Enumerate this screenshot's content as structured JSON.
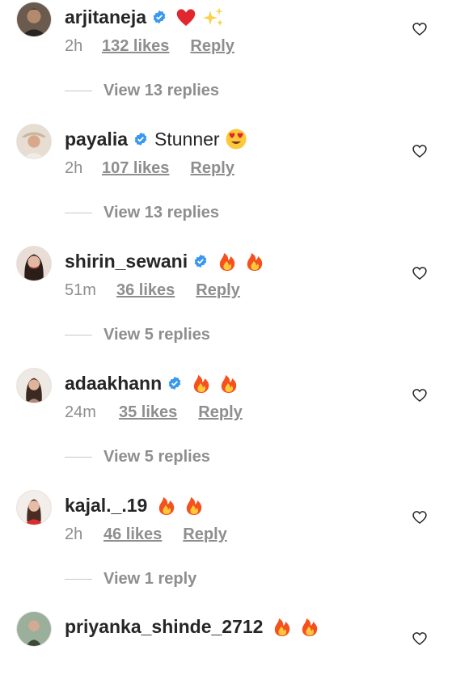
{
  "comments": [
    {
      "username": "arjitaneja",
      "verified": true,
      "text": "",
      "emojis": [
        "red-heart",
        "sparkles"
      ],
      "time": "2h",
      "likes": "132 likes",
      "reply": "Reply",
      "view_replies": "View 13 replies"
    },
    {
      "username": "payalia",
      "verified": true,
      "text": "Stunner",
      "emojis": [
        "heart-eyes"
      ],
      "time": "2h",
      "likes": "107 likes",
      "reply": "Reply",
      "view_replies": "View 13 replies"
    },
    {
      "username": "shirin_sewani",
      "verified": true,
      "text": "",
      "emojis": [
        "fire",
        "fire"
      ],
      "time": "51m",
      "likes": "36 likes",
      "reply": "Reply",
      "view_replies": "View 5 replies"
    },
    {
      "username": "adaakhann",
      "verified": true,
      "text": "",
      "emojis": [
        "fire",
        "fire"
      ],
      "time": "24m",
      "likes": "35 likes",
      "reply": "Reply",
      "view_replies": "View 5 replies"
    },
    {
      "username": "kajal._.19",
      "verified": false,
      "text": "",
      "emojis": [
        "fire",
        "fire"
      ],
      "time": "2h",
      "likes": "46 likes",
      "reply": "Reply",
      "view_replies": "View 1 reply"
    },
    {
      "username": "priyanka_shinde_2712",
      "verified": false,
      "text": "",
      "emojis": [
        "fire",
        "fire"
      ]
    }
  ],
  "colors": {
    "text": "#262626",
    "meta": "#8e8e8e",
    "verified": "#3897f0"
  }
}
